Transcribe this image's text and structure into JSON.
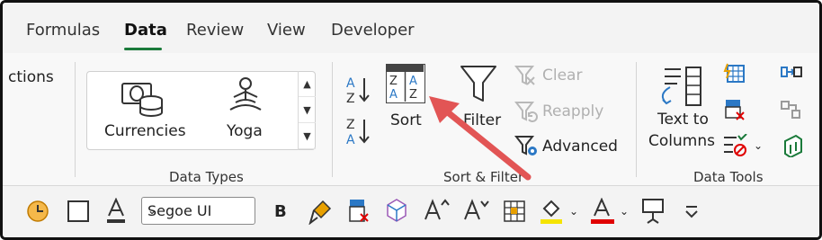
{
  "tabs": [
    {
      "label": "Formulas"
    },
    {
      "label": "Data",
      "active": true
    },
    {
      "label": "Review"
    },
    {
      "label": "View"
    },
    {
      "label": "Developer"
    }
  ],
  "ribbon": {
    "partial_label": "ctions",
    "data_types": {
      "items": [
        {
          "label": "Currencies",
          "icon": "currencies-icon"
        },
        {
          "label": "Yoga",
          "icon": "yoga-icon"
        }
      ],
      "group_label": "Data Types"
    },
    "sort_filter": {
      "sort_label": "Sort",
      "filter_label": "Filter",
      "clear_label": "Clear",
      "reapply_label": "Reapply",
      "advanced_label": "Advanced",
      "group_label": "Sort & Filter",
      "sort_az_letters": [
        "A",
        "Z"
      ],
      "sort_za_letters": [
        "Z",
        "A"
      ]
    },
    "data_tools": {
      "text_to_columns_line1": "Text to",
      "text_to_columns_line2": "Columns",
      "group_label": "Data Tools"
    }
  },
  "qat": {
    "font_name": "Segoe UI",
    "bold_label": "B"
  },
  "colors": {
    "accent_green": "#1a7a3a",
    "arrow_red": "#e25555",
    "highlight_yellow": "#f5e400",
    "font_red": "#e00000",
    "sort_blue": "#2b78c5"
  }
}
